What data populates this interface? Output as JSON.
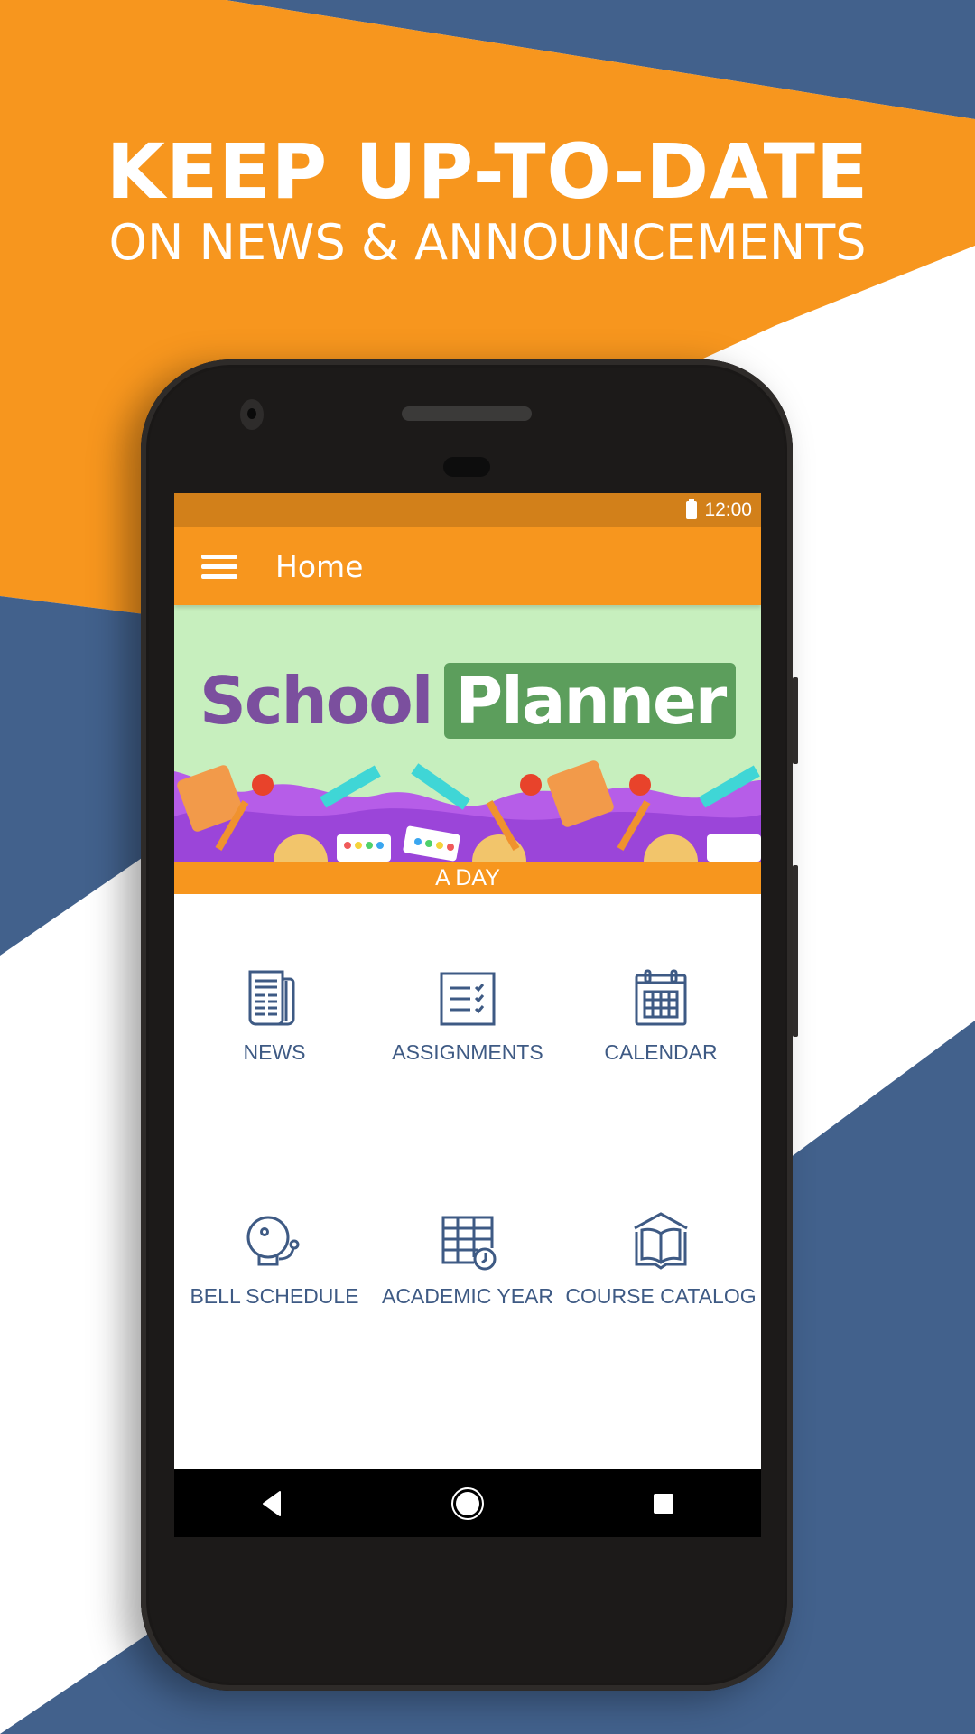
{
  "promo": {
    "headline": "KEEP UP-TO-DATE",
    "subheadline": "ON NEWS & ANNOUNCEMENTS"
  },
  "colors": {
    "orange": "#f7961e",
    "status_orange": "#d2801a",
    "navy": "#42618c",
    "icon_blue": "#3e5a84"
  },
  "status_bar": {
    "battery_icon": "battery-full-icon",
    "time": "12:00"
  },
  "app_bar": {
    "menu_icon": "hamburger-menu-icon",
    "title": "Home"
  },
  "banner": {
    "title_part1": "School",
    "title_part2": "Planner"
  },
  "day_label": "A DAY",
  "menu": [
    {
      "label": "NEWS",
      "icon": "newspaper-icon"
    },
    {
      "label": "ASSIGNMENTS",
      "icon": "checklist-icon"
    },
    {
      "label": "CALENDAR",
      "icon": "calendar-icon"
    },
    {
      "label": "BELL SCHEDULE",
      "icon": "bell-icon"
    },
    {
      "label": "ACADEMIC YEAR",
      "icon": "schedule-clock-icon"
    },
    {
      "label": "COURSE CATALOG",
      "icon": "open-book-icon"
    }
  ],
  "nav_bar": {
    "back": "back-triangle-icon",
    "home": "home-circle-icon",
    "recents": "recents-square-icon"
  }
}
